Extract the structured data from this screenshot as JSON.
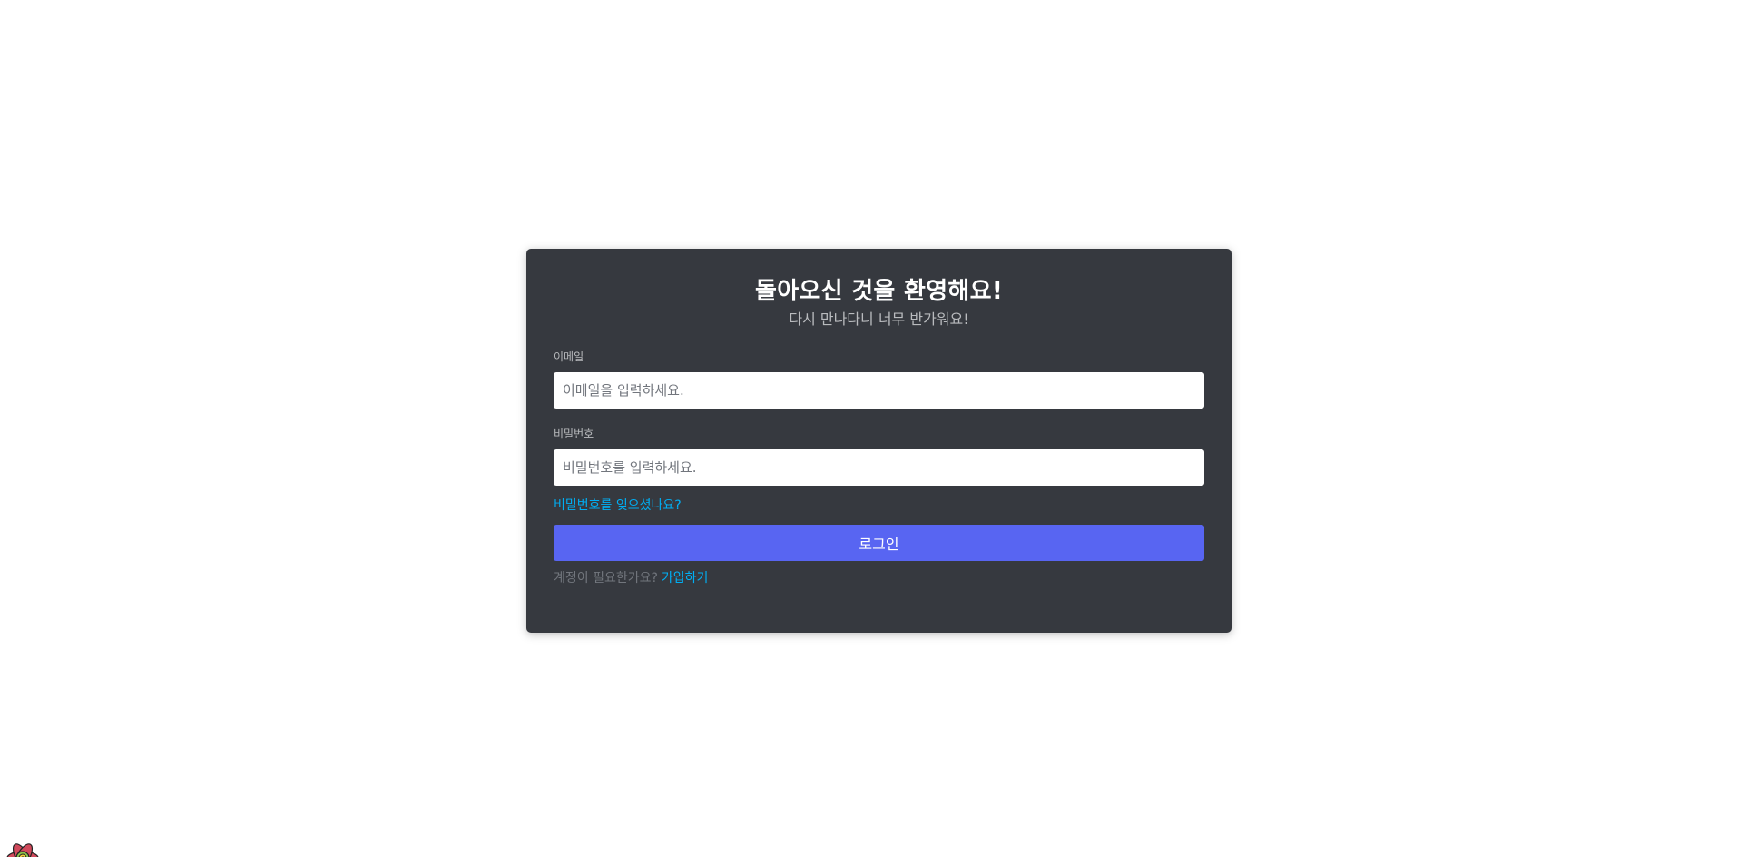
{
  "login_card": {
    "title": "돌아오신 것을 환영해요!",
    "subtitle": "다시 만나다니 너무 반가워요!",
    "email": {
      "label": "이메일",
      "placeholder": "이메일을 입력하세요.",
      "value": ""
    },
    "password": {
      "label": "비밀번호",
      "placeholder": "비밀번호를 입력하세요.",
      "value": ""
    },
    "forgot_password_link": "비밀번호를 잊으셨나요?",
    "login_button": "로그인",
    "register_prompt": "계정이 필요한가요?",
    "register_link": "가입하기"
  },
  "floating_widget": {
    "icon": "react-query-devtools-flower-icon"
  },
  "colors": {
    "background": "#ffffff",
    "card": "#36393f",
    "title": "#ffffff",
    "subtitle": "#b9bbbe",
    "link": "#00aff4",
    "button": "#5865f2",
    "muted_text": "#72767d"
  }
}
